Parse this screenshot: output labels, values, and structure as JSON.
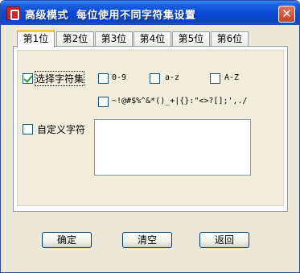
{
  "window": {
    "title": "高级模式  每位使用不同字符集设置",
    "close_label": "✕"
  },
  "tabs": [
    "第1位",
    "第2位",
    "第3位",
    "第4位",
    "第5位",
    "第6位"
  ],
  "active_tab_index": 0,
  "charsets": {
    "select_label": "选择字符集",
    "select_checked": true,
    "digits": {
      "label": "0-9",
      "checked": false
    },
    "lowercase": {
      "label": "a-z",
      "checked": false
    },
    "uppercase": {
      "label": "A-Z",
      "checked": false
    },
    "symbols": {
      "label": "~!@#$%^&*()_+|{}:\"<>?[];',./",
      "checked": false
    }
  },
  "custom": {
    "label": "自定义字符",
    "checked": false,
    "value": ""
  },
  "buttons": {
    "ok": "确定",
    "clear": "清空",
    "back": "返回"
  },
  "colors": {
    "titlebar": "#0a4ad6",
    "dialog_bg": "#ece9d8",
    "active_tab_accent": "#ffc83c",
    "close_button": "#c8421f"
  }
}
